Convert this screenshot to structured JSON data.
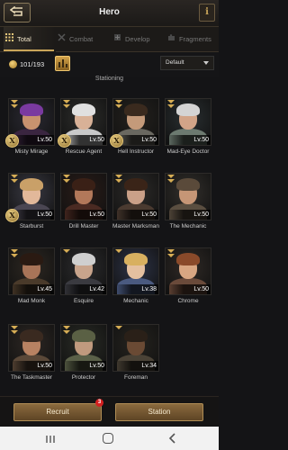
{
  "header": {
    "title": "Hero",
    "info_label": "i"
  },
  "tabs": [
    {
      "label": "Total",
      "active": true,
      "icon": "grid-icon"
    },
    {
      "label": "Combat",
      "active": false,
      "icon": "combat-icon"
    },
    {
      "label": "Develop",
      "active": false,
      "icon": "develop-icon"
    },
    {
      "label": "Fragments",
      "active": false,
      "icon": "puzzle-icon"
    }
  ],
  "filter": {
    "count": "101/193",
    "sort_value": "Default"
  },
  "section_title": "Stationing",
  "heroes": [
    {
      "name": "Misty Mirage",
      "level": "Lv.50",
      "ranks": 2,
      "x_badge": "X",
      "skin": "#c8926f",
      "hair": "#7a3aa0",
      "bg": "#2b2a33",
      "body": "#3a2540"
    },
    {
      "name": "Rescue Agent",
      "level": "Lv.50",
      "ranks": 2,
      "x_badge": "X",
      "skin": "#d8b197",
      "hair": "#e0e0e0",
      "bg": "#2e2e2c",
      "body": "#c9c9c9"
    },
    {
      "name": "Hell Instructor",
      "level": "Lv.50",
      "ranks": 2,
      "x_badge": "X",
      "skin": "#c49a7a",
      "hair": "#3a2a1e",
      "bg": "#25221e",
      "body": "#6a6860"
    },
    {
      "name": "Mad-Eye Doctor",
      "level": "Lv.50",
      "ranks": 2,
      "x_badge": "",
      "skin": "#d2a488",
      "hair": "#d4d4d4",
      "bg": "#2a3032",
      "body": "#6c7a70"
    },
    {
      "name": "Starburst",
      "level": "Lv.50",
      "ranks": 2,
      "x_badge": "X",
      "skin": "#e2b89a",
      "hair": "#c9a068",
      "bg": "#3a3a44",
      "body": "#4a4652"
    },
    {
      "name": "Drill Master",
      "level": "Lv.50",
      "ranks": 2,
      "x_badge": "",
      "skin": "#b2785a",
      "hair": "#3a2016",
      "bg": "#2a1c18",
      "body": "#4a2a22"
    },
    {
      "name": "Master Marksman",
      "level": "Lv.50",
      "ranks": 2,
      "x_badge": "",
      "skin": "#caa088",
      "hair": "#3a2418",
      "bg": "#2e2c2a",
      "body": "#4a3a30"
    },
    {
      "name": "The Mechanic",
      "level": "Lv.50",
      "ranks": 2,
      "x_badge": "",
      "skin": "#c69676",
      "hair": "#5a4a3a",
      "bg": "#33302c",
      "body": "#5a4e40"
    },
    {
      "name": "Mad Monk",
      "level": "Lv.45",
      "ranks": 2,
      "x_badge": "",
      "skin": "#a87458",
      "hair": "#2a1a12",
      "bg": "#2e2822",
      "body": "#4a3a2a"
    },
    {
      "name": "Esquire",
      "level": "Lv.42",
      "ranks": 1,
      "x_badge": "",
      "skin": "#c8a48c",
      "hair": "#cfcfcf",
      "bg": "#2c2c2e",
      "body": "#3a3a40"
    },
    {
      "name": "Mechanic",
      "level": "Lv.38",
      "ranks": 1,
      "x_badge": "",
      "skin": "#e4c0a0",
      "hair": "#d8b060",
      "bg": "#2e3448",
      "body": "#4a5a80"
    },
    {
      "name": "Chrome",
      "level": "Lv.50",
      "ranks": 2,
      "x_badge": "",
      "skin": "#d8a682",
      "hair": "#8a4a2a",
      "bg": "#302a26",
      "body": "#6a4a3a"
    },
    {
      "name": "The Taskmaster",
      "level": "Lv.50",
      "ranks": 2,
      "x_badge": "",
      "skin": "#b88262",
      "hair": "#3a2a20",
      "bg": "#2e2824",
      "body": "#5a4838"
    },
    {
      "name": "Protector",
      "level": "Lv.50",
      "ranks": 2,
      "x_badge": "",
      "skin": "#c09a7e",
      "hair": "#5a6044",
      "bg": "#2a2c26",
      "body": "#5a6048"
    },
    {
      "name": "Foreman",
      "level": "Lv.34",
      "ranks": 1,
      "x_badge": "",
      "skin": "#6a4a34",
      "hair": "#2a2018",
      "bg": "#26241f",
      "body": "#4a4236"
    }
  ],
  "bottom": {
    "recruit_label": "Recruit",
    "recruit_badge": "3",
    "station_label": "Station"
  },
  "colors": {
    "accent": "#c9a55a",
    "button": "#7a5a32",
    "badge": "#d32020"
  }
}
